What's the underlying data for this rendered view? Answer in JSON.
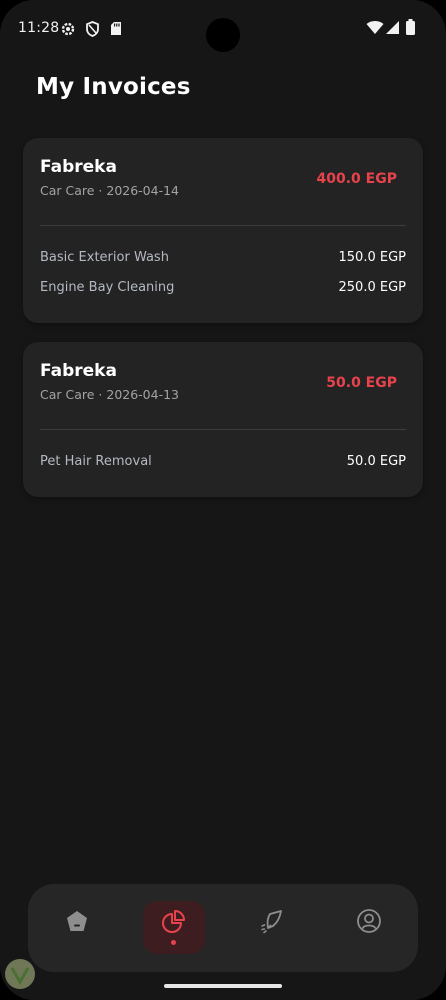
{
  "status_bar": {
    "time": "11:28",
    "left_icons": [
      "gear-icon",
      "shield-icon",
      "sd-card-icon"
    ],
    "right_icons": [
      "wifi-icon",
      "signal-icon",
      "battery-icon"
    ]
  },
  "page": {
    "title": "My Invoices"
  },
  "invoices": [
    {
      "vendor": "Fabreka",
      "meta": "Car Care · 2026-04-14",
      "total": "400.0 EGP",
      "items": [
        {
          "name": "Basic Exterior Wash",
          "price": "150.0 EGP"
        },
        {
          "name": "Engine Bay Cleaning",
          "price": "250.0 EGP"
        }
      ]
    },
    {
      "vendor": "Fabreka",
      "meta": "Car Care · 2026-04-13",
      "total": "50.0 EGP",
      "items": [
        {
          "name": "Pet Hair Removal",
          "price": "50.0 EGP"
        }
      ]
    }
  ],
  "bottom_nav": {
    "items": [
      {
        "id": "home",
        "icon": "home-icon",
        "active": false
      },
      {
        "id": "invoices",
        "icon": "pie-chart-icon",
        "active": true
      },
      {
        "id": "services",
        "icon": "spray-icon",
        "active": false
      },
      {
        "id": "profile",
        "icon": "profile-icon",
        "active": false
      }
    ]
  },
  "colors": {
    "background": "#161616",
    "card": "#232323",
    "accent": "#e8434d",
    "text_primary": "#ffffff",
    "text_secondary": "#a3a3a3"
  }
}
